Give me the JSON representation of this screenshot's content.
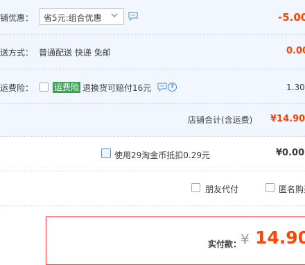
{
  "shop": {
    "discount": {
      "label": "铺优惠：",
      "selected": "省5元:组合优惠",
      "amount": "-5.00",
      "chevron_icon": "chevron-down-icon",
      "message_icon": "message-icon"
    },
    "delivery": {
      "label": "送方式：",
      "value": "普通配送 快递 免邮",
      "amount": "0.00"
    },
    "insurance": {
      "label": "运费险：",
      "tag": "运费险",
      "desc": "退换货可赔付16元",
      "amount": "1.30",
      "help": "?",
      "checked": false
    },
    "subtotal": {
      "label": "店铺合计(含运费)",
      "amount": "¥14.90"
    }
  },
  "coins": {
    "label": "使用29淘金币抵扣0.29元",
    "amount": "¥0.00",
    "checked": false
  },
  "options": {
    "friend_pay": "朋友代付",
    "anonymous": "匿名购买"
  },
  "payment": {
    "label": "实付款：",
    "currency": "¥",
    "amount": "14.90"
  },
  "colors": {
    "accent": "#ff4400",
    "shop_bg": "#f2f7ff",
    "insurance_tag": "#3aa254",
    "pay_border": "#ff3a3a"
  }
}
